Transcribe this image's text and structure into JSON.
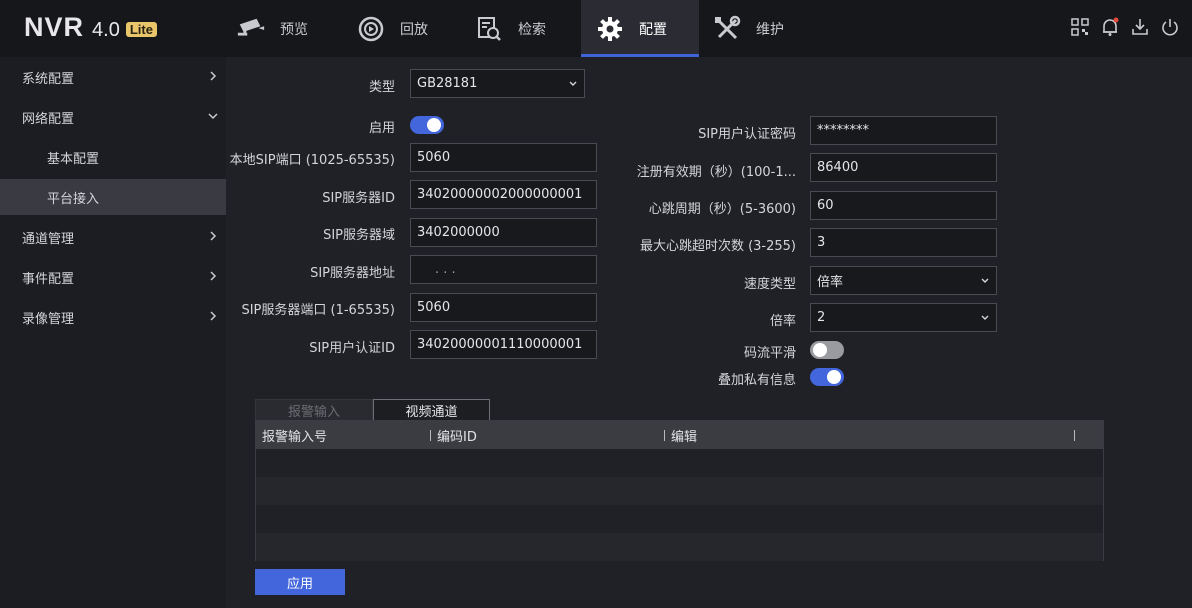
{
  "header": {
    "logo_text": "NVR",
    "logo_version": "4.0",
    "logo_badge": "Lite",
    "nav": [
      {
        "label": "预览",
        "icon": "camera-icon"
      },
      {
        "label": "回放",
        "icon": "playback-icon"
      },
      {
        "label": "检索",
        "icon": "search-document-icon"
      },
      {
        "label": "配置",
        "icon": "gear-icon",
        "active": true
      },
      {
        "label": "维护",
        "icon": "wrench-icon"
      }
    ],
    "right_icons": [
      "qrcode-icon",
      "bell-icon",
      "download-icon",
      "power-icon"
    ]
  },
  "sidebar": {
    "items": [
      {
        "label": "系统配置",
        "chevron": "right"
      },
      {
        "label": "网络配置",
        "chevron": "down"
      },
      {
        "label": "基本配置",
        "sub": true
      },
      {
        "label": "平台接入",
        "sub": true,
        "selected": true
      },
      {
        "label": "通道管理",
        "chevron": "right"
      },
      {
        "label": "事件配置",
        "chevron": "right"
      },
      {
        "label": "录像管理",
        "chevron": "right"
      }
    ]
  },
  "form": {
    "type_label": "类型",
    "type_value": "GB28181",
    "enable_label": "启用",
    "enable_on": true,
    "local_port_label": "本地SIP端口 (1025-65535)",
    "local_port_value": "5060",
    "server_id_label": "SIP服务器ID",
    "server_id_value": "34020000002000000001",
    "server_domain_label": "SIP服务器域",
    "server_domain_value": "3402000000",
    "server_addr_label": "SIP服务器地址",
    "server_addr_value": ".       .       .",
    "server_port_label": "SIP服务器端口 (1-65535)",
    "server_port_value": "5060",
    "user_id_label": "SIP用户认证ID",
    "user_id_value": "34020000001110000001",
    "password_label": "SIP用户认证密码",
    "password_value": "********",
    "register_label": "注册有效期（秒）(100-1...",
    "register_value": "86400",
    "heartbeat_label": "心跳周期（秒）(5-3600)",
    "heartbeat_value": "60",
    "max_timeout_label": "最大心跳超时次数 (3-255)",
    "max_timeout_value": "3",
    "speed_type_label": "速度类型",
    "speed_type_value": "倍率",
    "rate_label": "倍率",
    "rate_value": "2",
    "stream_smooth_label": "码流平滑",
    "stream_smooth_on": false,
    "overlay_label": "叠加私有信息",
    "overlay_on": true
  },
  "tabs": [
    {
      "label": "报警输入",
      "active": false
    },
    {
      "label": "视频通道",
      "active": true
    }
  ],
  "table": {
    "columns": [
      "报警输入号",
      "编码ID",
      "编辑"
    ]
  },
  "apply_label": "应用",
  "colors": {
    "accent": "#4366dc",
    "background": "#202126",
    "topbar": "#16171b",
    "badge": "#e9c66a"
  }
}
